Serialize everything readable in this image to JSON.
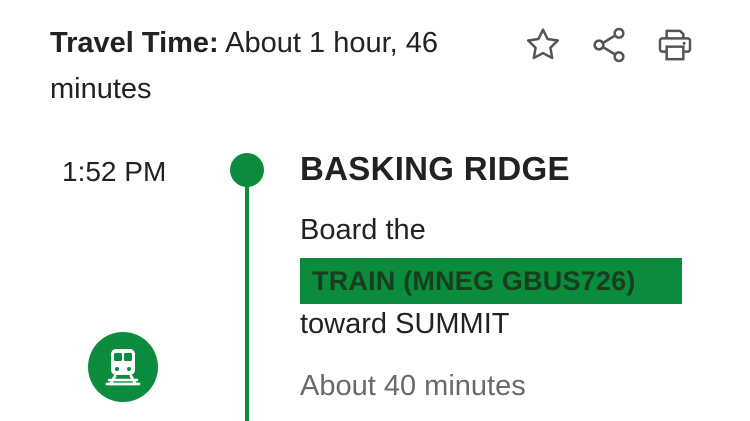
{
  "header": {
    "travel_time_label": "Travel Time:",
    "travel_time_value": " About 1 hour, 46 minutes"
  },
  "actions": {
    "favorite_icon": "star-outline-icon",
    "share_icon": "share-icon",
    "print_icon": "printer-icon"
  },
  "step": {
    "time": "1:52 PM",
    "station": "BASKING RIDGE",
    "board_text": "Board the",
    "route": "TRAIN (MNEG GBUS726)",
    "toward": "toward SUMMIT",
    "duration": "About 40 minutes",
    "mode_icon": "train-icon"
  },
  "colors": {
    "accent": "#0a8c3c",
    "route_text": "#173e20",
    "muted_text": "#6a6a6a"
  }
}
